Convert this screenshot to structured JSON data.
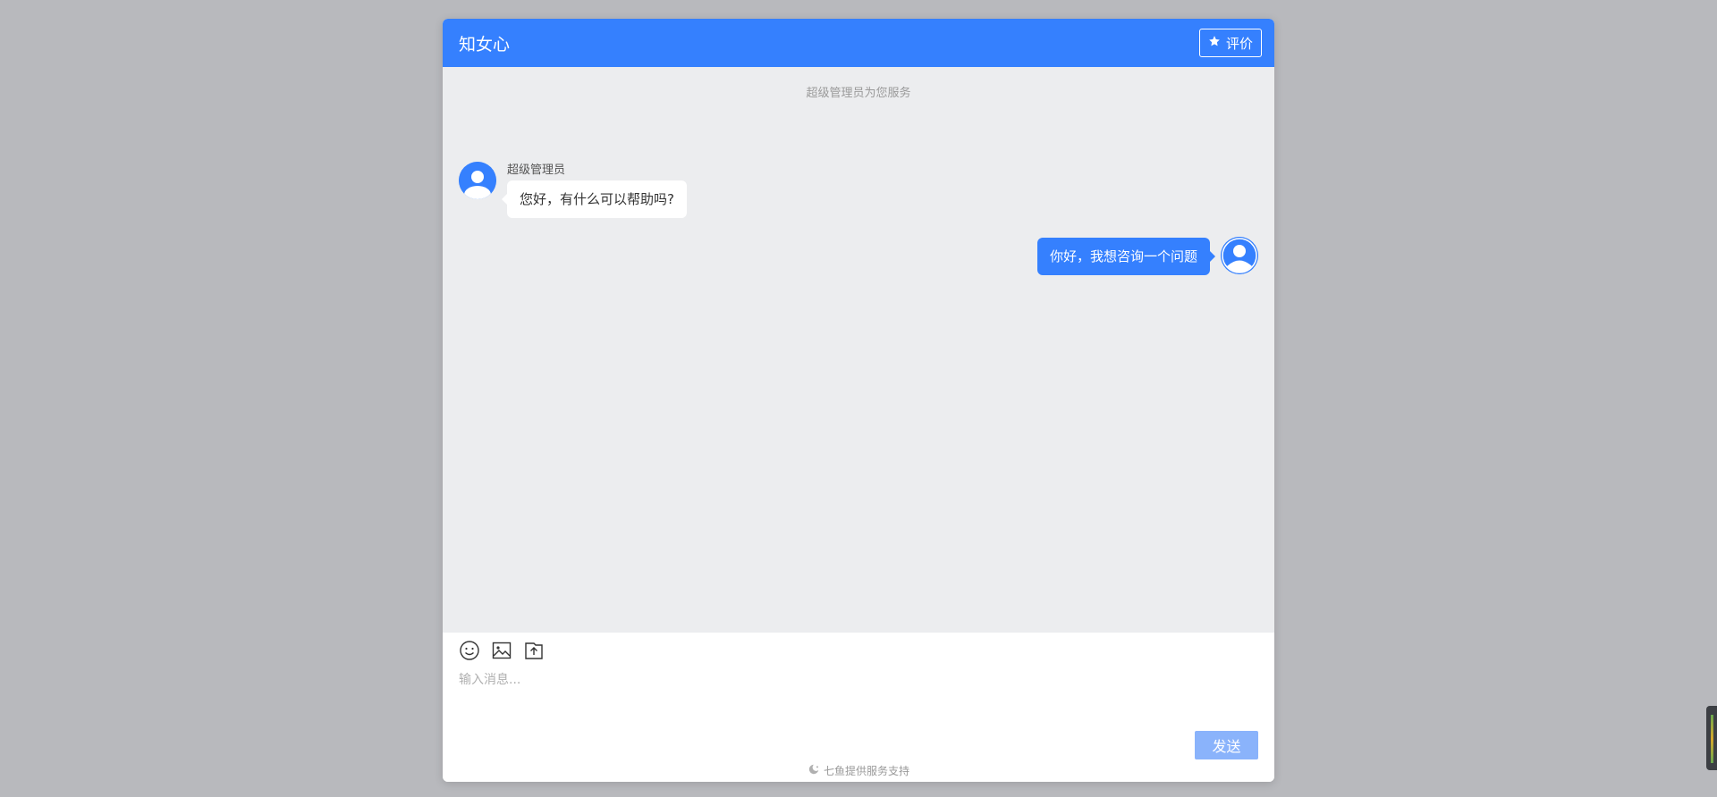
{
  "header": {
    "title": "知女心",
    "rate_label": "评价"
  },
  "messages": {
    "service_notice": "超级管理员为您服务",
    "agent_name": "超级管理员",
    "agent_message": "您好，有什么可以帮助吗?",
    "user_message": "你好，我想咨询一个问题"
  },
  "composer": {
    "placeholder": "输入消息...",
    "value": "",
    "send_label": "发送",
    "tools": [
      "emoji-icon",
      "image-icon",
      "upload-icon"
    ]
  },
  "footer": {
    "text": "七鱼提供服务支持"
  },
  "colors": {
    "accent": "#3580fe",
    "send_disabled": "#8ab3fb",
    "message_area": "#ecedef",
    "backdrop": "#b8b9bd"
  }
}
